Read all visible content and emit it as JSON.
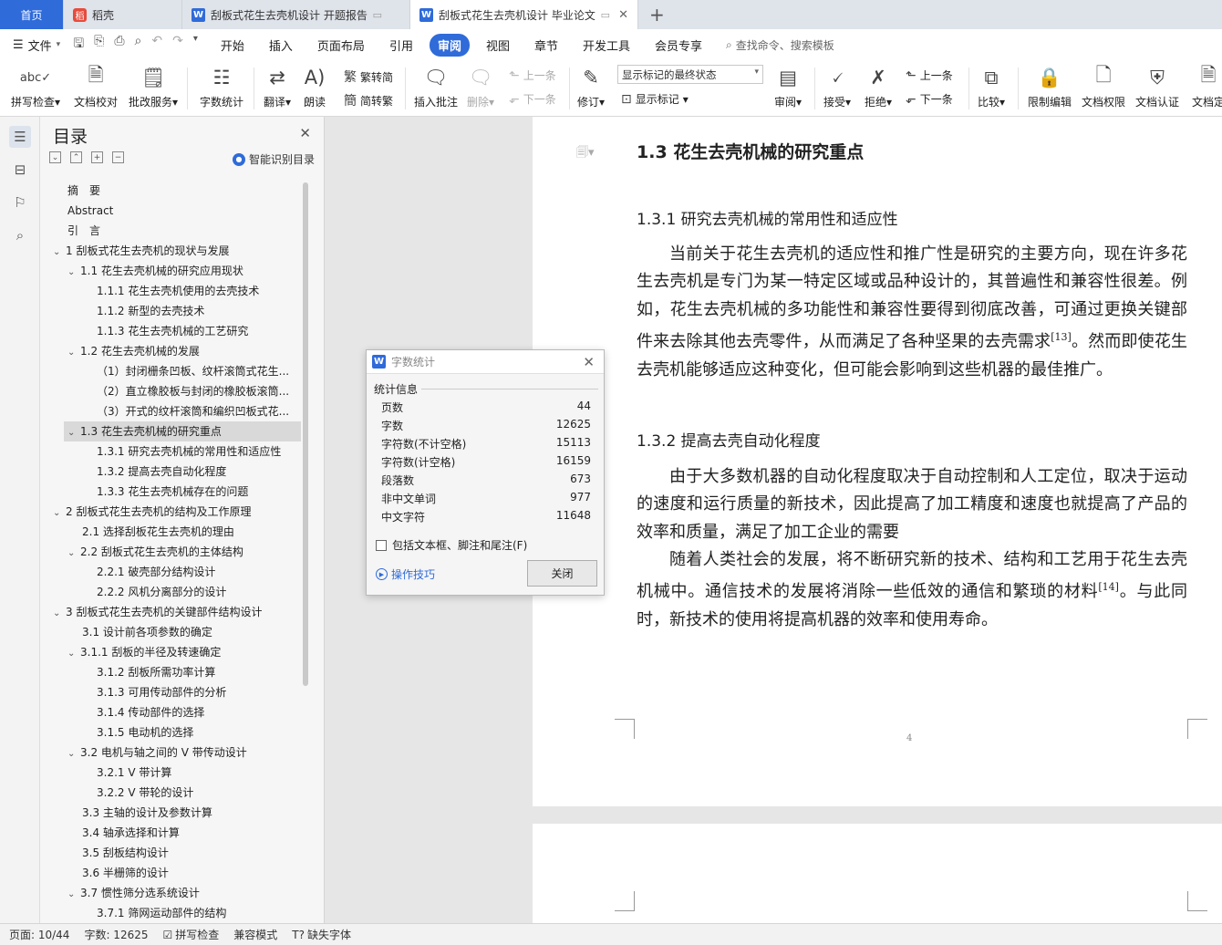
{
  "tabs": {
    "home": "首页",
    "daoke": "稻壳",
    "doc1": "刮板式花生去壳机设计 开题报告",
    "doc2": "刮板式花生去壳机设计 毕业论文",
    "new_tab": "+"
  },
  "menubar": {
    "file": "文件",
    "items": [
      "开始",
      "插入",
      "页面布局",
      "引用",
      "审阅",
      "视图",
      "章节",
      "开发工具",
      "会员专享"
    ],
    "active_index": 4,
    "search": "查找命令、搜索模板"
  },
  "ribbon": {
    "spell_check": "拼写检查",
    "doc_proof": "文档校对",
    "annot_service": "批改服务",
    "word_count": "字数统计",
    "translate": "翻译",
    "read_aloud": "朗读",
    "trad": "繁转简",
    "simp": "简转繁",
    "insert_comment": "插入批注",
    "delete": "删除",
    "prev": "上一条",
    "next": "下一条",
    "revise": "修订",
    "markup_state": "显示标记的最终状态",
    "show_markup": "显示标记",
    "review": "审阅",
    "accept": "接受",
    "reject": "拒绝",
    "prev2": "上一条",
    "next2": "下一条",
    "compare": "比较",
    "restrict": "限制编辑",
    "doc_perm": "文档权限",
    "doc_cert": "文档认证",
    "doc_final": "文档定"
  },
  "toc": {
    "title": "目录",
    "smart": "智能识别目录",
    "items": [
      {
        "text": "摘　要",
        "level": 0,
        "arrow": ""
      },
      {
        "text": "Abstract",
        "level": 0,
        "arrow": ""
      },
      {
        "text": "引　言",
        "level": 0,
        "arrow": ""
      },
      {
        "text": "1 刮板式花生去壳机的现状与发展",
        "level": 0,
        "arrow": "v"
      },
      {
        "text": "1.1 花生去壳机械的研究应用现状",
        "level": 1,
        "arrow": "v"
      },
      {
        "text": "1.1.1 花生去壳机使用的去壳技术",
        "level": 2,
        "arrow": ""
      },
      {
        "text": "1.1.2 新型的去壳技术",
        "level": 2,
        "arrow": ""
      },
      {
        "text": "1.1.3 花生去壳机械的工艺研究",
        "level": 2,
        "arrow": ""
      },
      {
        "text": "1.2 花生去壳机械的发展",
        "level": 1,
        "arrow": "v"
      },
      {
        "text": "（1）封闭栅条凹板、纹杆滚筒式花生...",
        "level": 2,
        "arrow": ""
      },
      {
        "text": "（2）直立橡胶板与封闭的橡胶板滚筒...",
        "level": 2,
        "arrow": ""
      },
      {
        "text": "（3）开式的纹杆滚筒和编织凹板式花...",
        "level": 2,
        "arrow": ""
      },
      {
        "text": "1.3 花生去壳机械的研究重点",
        "level": 1,
        "arrow": "v",
        "selected": true
      },
      {
        "text": "1.3.1 研究去壳机械的常用性和适应性",
        "level": 2,
        "arrow": ""
      },
      {
        "text": "1.3.2 提高去壳自动化程度",
        "level": 2,
        "arrow": ""
      },
      {
        "text": "1.3.3 花生去壳机械存在的问题",
        "level": 2,
        "arrow": ""
      },
      {
        "text": "2 刮板式花生去壳机的结构及工作原理",
        "level": 0,
        "arrow": "v"
      },
      {
        "text": "2.1 选择刮板花生去壳机的理由",
        "level": 1,
        "arrow": ""
      },
      {
        "text": "2.2 刮板式花生去壳机的主体结构",
        "level": 1,
        "arrow": "v"
      },
      {
        "text": "2.2.1 破壳部分结构设计",
        "level": 2,
        "arrow": ""
      },
      {
        "text": "2.2.2 风机分离部分的设计",
        "level": 2,
        "arrow": ""
      },
      {
        "text": "3 刮板式花生去壳机的关键部件结构设计",
        "level": 0,
        "arrow": "v"
      },
      {
        "text": "3.1 设计前各项参数的确定",
        "level": 1,
        "arrow": ""
      },
      {
        "text": "3.1.1 刮板的半径及转速确定",
        "level": 1,
        "arrow": "v"
      },
      {
        "text": "3.1.2 刮板所需功率计算",
        "level": 2,
        "arrow": ""
      },
      {
        "text": "3.1.3 可用传动部件的分析",
        "level": 2,
        "arrow": ""
      },
      {
        "text": "3.1.4 传动部件的选择",
        "level": 2,
        "arrow": ""
      },
      {
        "text": "3.1.5 电动机的选择",
        "level": 2,
        "arrow": ""
      },
      {
        "text": "3.2 电机与轴之间的 V 带传动设计",
        "level": 1,
        "arrow": "v"
      },
      {
        "text": "3.2.1 V 带计算",
        "level": 2,
        "arrow": ""
      },
      {
        "text": "3.2.2 V 带轮的设计",
        "level": 2,
        "arrow": ""
      },
      {
        "text": "3.3 主轴的设计及参数计算",
        "level": 1,
        "arrow": ""
      },
      {
        "text": "3.4 轴承选择和计算",
        "level": 1,
        "arrow": ""
      },
      {
        "text": "3.5 刮板结构设计",
        "level": 1,
        "arrow": ""
      },
      {
        "text": "3.6 半栅筛的设计",
        "level": 1,
        "arrow": ""
      },
      {
        "text": "3.7 惯性筛分选系统设计",
        "level": 1,
        "arrow": "v"
      },
      {
        "text": "3.7.1 筛网运动部件的结构",
        "level": 2,
        "arrow": ""
      }
    ]
  },
  "doc": {
    "h2": "1.3  花生去壳机械的研究重点",
    "h3a": "1.3.1  研究去壳机械的常用性和适应性",
    "p1a": "当前关于花生去壳机的适应性和推广性是研究的主要方向，现在许多花生去壳机是专门为某一特定区域或品种设计的，其普遍性和兼容性很差。例如，花生去壳机械的多功能性和兼容性要得到彻底改善，可通过更换关键部件来去除其他去壳零件，从而满足了各种坚果的去壳需求",
    "p1ref": "[13]",
    "p1b": "。然而即使花生去壳机能够适应这种变化，但可能会影响到这些机器的最佳推广。",
    "h3b": "1.3.2  提高去壳自动化程度",
    "p2": "由于大多数机器的自动化程度取决于自动控制和人工定位，取决于运动的速度和运行质量的新技术，因此提高了加工精度和速度也就提高了产品的效率和质量，满足了加工企业的需要",
    "p3a": "随着人类社会的发展，将不断研究新的技术、结构和工艺用于花生去壳机械中。通信技术的发展将消除一些低效的通信和繁琐的材料",
    "p3ref": "[14]",
    "p3b": "。与此同时，新技术的使用将提高机器的效率和使用寿命。",
    "page_number": "4"
  },
  "dialog": {
    "title": "字数统计",
    "section": "统计信息",
    "rows": [
      {
        "label": "页数",
        "value": "44"
      },
      {
        "label": "字数",
        "value": "12625"
      },
      {
        "label": "字符数(不计空格)",
        "value": "15113"
      },
      {
        "label": "字符数(计空格)",
        "value": "16159"
      },
      {
        "label": "段落数",
        "value": "673"
      },
      {
        "label": "非中文单词",
        "value": "977"
      },
      {
        "label": "中文字符",
        "value": "11648"
      }
    ],
    "checkbox": "包括文本框、脚注和尾注(F)",
    "tips": "操作技巧",
    "close": "关闭"
  },
  "status": {
    "page": "页面: 10/44",
    "words": "字数: 12625",
    "spell": "拼写检查",
    "compat": "兼容模式",
    "missing_font": "缺失字体"
  },
  "colors": {
    "accent": "#2f6bd9",
    "tabbar": "#dfe3ea"
  }
}
